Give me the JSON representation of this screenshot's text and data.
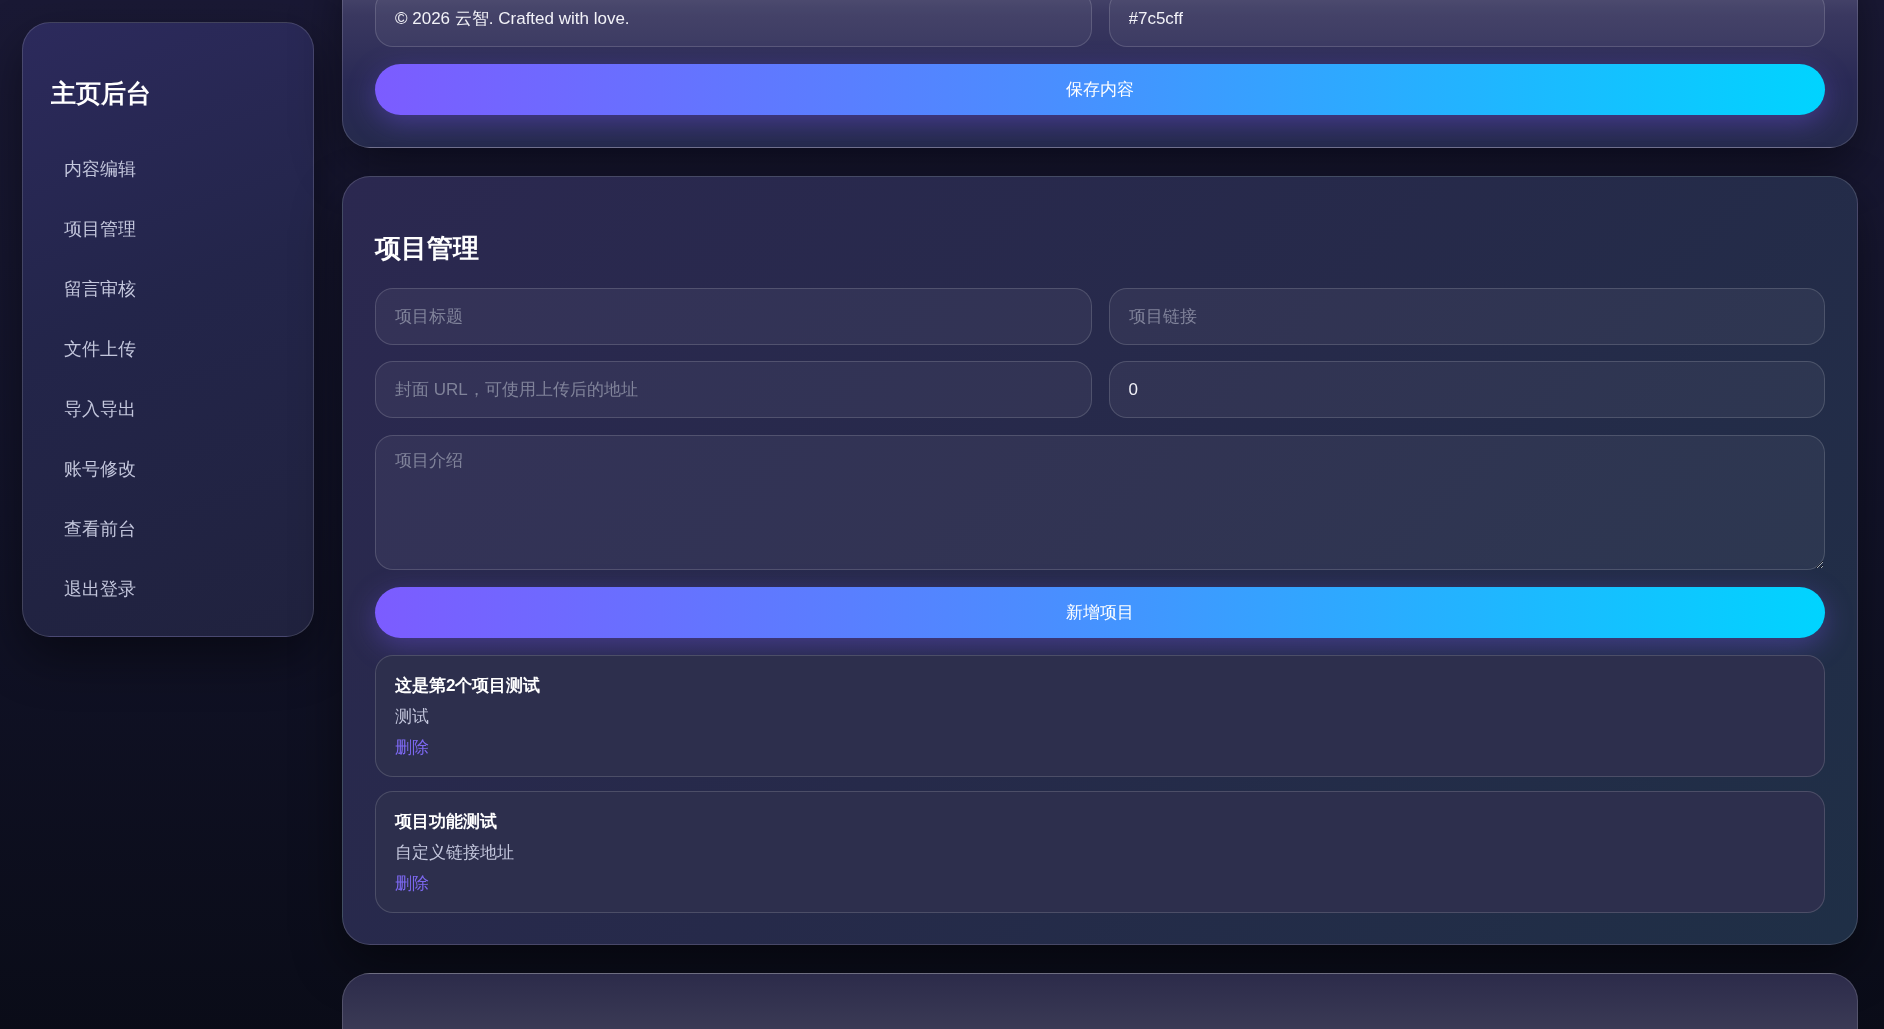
{
  "sidebar": {
    "title": "主页后台",
    "items": [
      {
        "label": "内容编辑"
      },
      {
        "label": "项目管理"
      },
      {
        "label": "留言审核"
      },
      {
        "label": "文件上传"
      },
      {
        "label": "导入导出"
      },
      {
        "label": "账号修改"
      },
      {
        "label": "查看前台"
      },
      {
        "label": "退出登录"
      }
    ]
  },
  "content_card": {
    "fields": [
      {
        "value": "© 2026 云智. Crafted with love."
      },
      {
        "value": "#7c5cff"
      }
    ],
    "save_button": "保存内容"
  },
  "project_card": {
    "title": "项目管理",
    "fields": [
      {
        "placeholder": "项目标题"
      },
      {
        "placeholder": "项目链接"
      },
      {
        "placeholder": "封面 URL，可使用上传后的地址"
      },
      {
        "value": "0"
      }
    ],
    "description_field": {
      "placeholder": "项目介绍"
    },
    "add_button": "新增项目",
    "projects": [
      {
        "title": "这是第2个项目测试",
        "description": "测试",
        "delete_link": "删除"
      },
      {
        "title": "项目功能测试",
        "description": "自定义链接地址",
        "delete_link": "删除"
      }
    ]
  }
}
